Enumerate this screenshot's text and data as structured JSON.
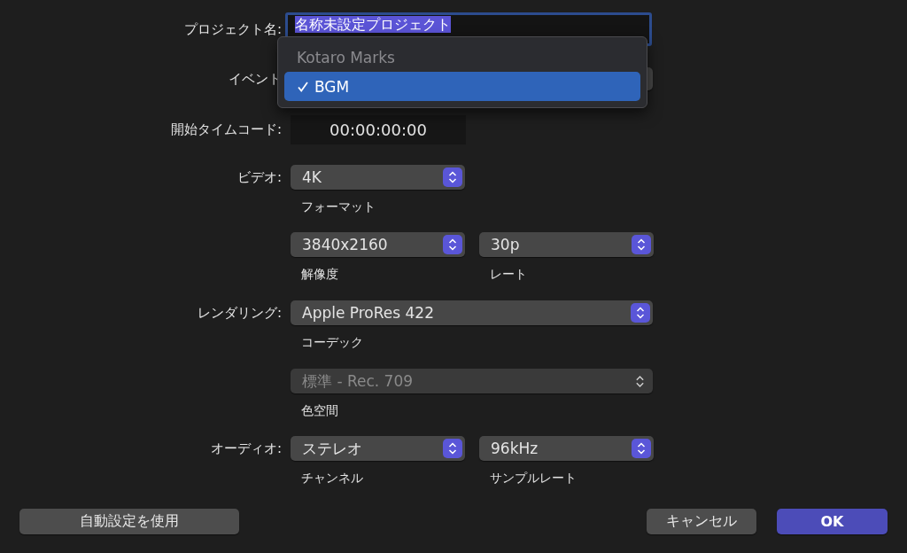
{
  "project_name": {
    "label": "プロジェクト名:",
    "value": "名称未設定プロジェクト",
    "selected": true
  },
  "event": {
    "label": "イベント",
    "menu": [
      {
        "label": "Kotaro Marks",
        "disabled": true,
        "selected": false
      },
      {
        "label": "BGM",
        "disabled": false,
        "selected": true
      }
    ]
  },
  "start_timecode": {
    "label": "開始タイムコード:",
    "value": "00:00:00:00"
  },
  "video": {
    "label": "ビデオ:",
    "format": {
      "value": "4K",
      "caption": "フォーマット",
      "disabled": false
    },
    "resolution": {
      "value": "3840x2160",
      "caption": "解像度",
      "disabled": false
    },
    "rate": {
      "value": "30p",
      "caption": "レート",
      "disabled": false
    }
  },
  "rendering": {
    "label": "レンダリング:",
    "codec": {
      "value": "Apple ProRes 422",
      "caption": "コーデック",
      "disabled": false
    },
    "color_space": {
      "value": "標準 - Rec. 709",
      "caption": "色空間",
      "disabled": true
    }
  },
  "audio": {
    "label": "オーディオ:",
    "channels": {
      "value": "ステレオ",
      "caption": "チャンネル",
      "disabled": false
    },
    "sample_rate": {
      "value": "96kHz",
      "caption": "サンプルレート",
      "disabled": false
    }
  },
  "buttons": [
    {
      "label": "自動設定を使用",
      "kind": "secondary"
    },
    {
      "label": "キャンセル",
      "kind": "secondary"
    },
    {
      "label": "OK",
      "kind": "default"
    }
  ]
}
